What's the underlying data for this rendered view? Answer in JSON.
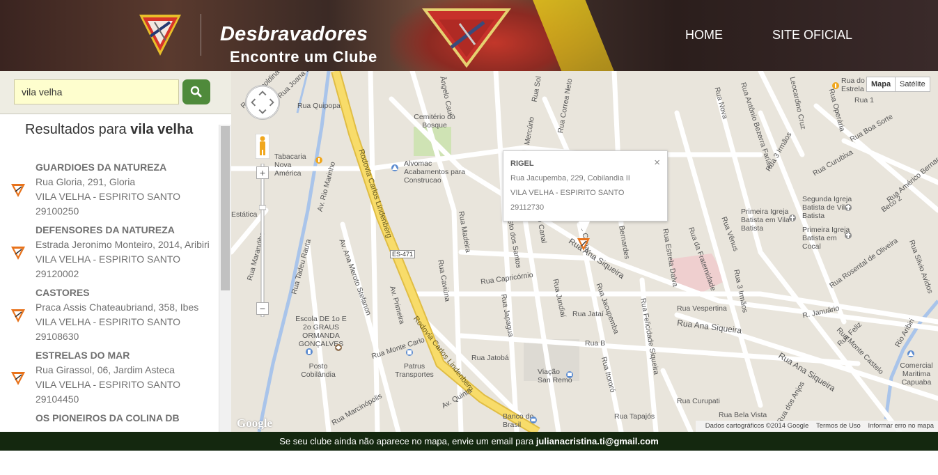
{
  "header": {
    "title": "Desbravadores",
    "subtitle": "Encontre um Clube",
    "nav": [
      "HOME",
      "SITE OFICIAL"
    ]
  },
  "search": {
    "value": "vila velha",
    "button_icon": "search-icon"
  },
  "results": {
    "prefix": "Resultados para",
    "query": "vila velha",
    "items": [
      {
        "name": "GUARDIOES DA NATUREZA",
        "address": "Rua Gloria, 291, Gloria",
        "city": "VILA VELHA - ESPIRITO SANTO",
        "cep": "29100250"
      },
      {
        "name": "DEFENSORES DA NATUREZA",
        "address": "Estrada Jeronimo Monteiro, 2014, Aribiri",
        "city": "VILA VELHA - ESPIRITO SANTO",
        "cep": "29120002"
      },
      {
        "name": "CASTORES",
        "address": "Praca Assis Chateaubriand, 358, Ibes",
        "city": "VILA VELHA - ESPIRITO SANTO",
        "cep": "29108630"
      },
      {
        "name": "ESTRELAS DO MAR",
        "address": "Rua Girassol, 06, Jardim Asteca",
        "city": "VILA VELHA - ESPIRITO SANTO",
        "cep": "29104450"
      },
      {
        "name": "OS PIONEIROS DA COLINA DB",
        "address": "",
        "city": "",
        "cep": ""
      }
    ]
  },
  "map": {
    "type_buttons": [
      "Mapa",
      "Satélite"
    ],
    "zoom_in": "+",
    "zoom_out": "−",
    "info": {
      "name": "RIGEL",
      "address": "Rua Jacupemba, 229, Cobilandia II",
      "city": "VILA VELHA - ESPIRITO SANTO",
      "cep": "29112730",
      "close": "×"
    },
    "labels": {
      "highway_1": "Rodovia Carlos Lindenberg",
      "highway_2": "Rodovia Carlos Lindenberg",
      "es471": "ES-471",
      "rua_quipopa": "Rua Quipopa",
      "cemiterio": "Cemitério do Bosque",
      "alvomac": "Alvomac Acabamentos para Construcao",
      "rua_capricornio": "Rua Capricórnio",
      "rua_ana_siqueira_1": "Rua Ana Siqueira",
      "rua_ana_siqueira_2": "Rua Ana Siqueira",
      "rua_ana_siqueira_3": "Rua Ana Siqueira",
      "rua_vespertina": "Rua Vespertina",
      "rua_janu": "R. Januário",
      "rua_monte_carlo": "Rua Monte Carlo",
      "escola": "Escola DE 1o E 2o GRAUS ORMANDA GONÇALVES",
      "posto": "Posto Cobilândia",
      "patrus": "Patrus Transportes",
      "viacao": "Viação San Remo",
      "banco": "Banco do Brasil",
      "igreja1": "Primeira Igreja Batista em Vila Batista",
      "igreja2": "Segunda Igreja Batista de Vila Batista",
      "igreja3": "Primeira Igreja Batista em Cocal",
      "comercial": "Comercial Maritima Capuaba",
      "rua_jacupemba": "Rua Jacupemba",
      "rua_jatai": "Rua Jataí",
      "rua_jatoba": "Rua Jatobá",
      "rua_jundiai": "Rua Jundiaí",
      "rua_japagua": "Rua Japagua",
      "rua_madeira": "Rua Madeira",
      "rua_caviuna": "Rua Caviúna",
      "av_primeira": "Av. Primeira",
      "av_quinta": "Av. Quinta",
      "rua_felicidade": "Rua Felicidade Siqueira",
      "rua_curupati": "Rua Curupati",
      "rua_bela_vista": "Rua Bela Vista",
      "rua_tapajos": "Rua Tapajós",
      "rua_estrela_dalva": "Rua Estrela Dalva",
      "rua_da_fraternidade": "Rua da Fraternidade",
      "rua_3_irmaos": "Rua 3 Irmãos",
      "rua_venus": "Rua Vênus",
      "rua_rosental": "Rua Rosental de Oliveira",
      "rua_silvio": "Rua Silvio Avidos",
      "rua_monte_castelo": "Rua Monte Castelo",
      "rio_aribiri": "Rio Aribiri",
      "av_rio_marinho": "Av. Rio Marinho",
      "av_ana_meroto": "Av. Ana Meroto Stefanon",
      "rua_tadeu_rauta": "Rua Tadeu Rauta",
      "rua_1": "Rua 1",
      "rua_boa_sorte": "Rua Boa Sorte",
      "rua_curubixa": "Rua Curubixa",
      "beco_2": "Beco 2",
      "rua_americo": "Rua Américo Bernardes",
      "rua_b": "Rua B",
      "rua_itororo": "Rua Itororó",
      "rua_bernardes": "Bernardes",
      "rua_feliz": "Rua Feliz",
      "rua_angelo": "Ângelo Cauí",
      "rua_leopoldina": "Rua Leopoldina",
      "rua_operaria": "Rua Operária",
      "rua_nova": "Rua Nova",
      "rua_antonio": "Rua Antônio Bezerra Farias",
      "rua_leocardino": "Leocardino Cruz",
      "rua_tres_irmaos_top": "Rua 3 Irmãos",
      "rua_ernesto": "Av. Ernesto Canal",
      "rua_estrela": "Rua Ernesto Canal",
      "rua_augusto": "Rua Augusto dos Santos",
      "rua_marcinopolis": "Rua Marcinópolis",
      "rua_anjos": "Rua dos Anjos",
      "tabacaria": "Tabacaria Nova América",
      "estatica": "Estática",
      "rua_marandibe": "Rua Marandibe",
      "rua_joana": "Rua Joana D",
      "rua_correa": "Rua Correa Neto",
      "mercurio": "Mercúrio",
      "rua_sol": "Rua Sol",
      "padaria": "Rua do Mar Estrela Da"
    },
    "attribution": [
      "Dados cartográficos ©2014 Google",
      "Termos de Uso",
      "Informar erro no mapa"
    ],
    "google": "Google"
  },
  "footer": {
    "text": "Se seu clube ainda não aparece no mapa, envie um email para",
    "email": "julianacristina.ti@gmail.com"
  },
  "colors": {
    "search_button": "#4f8a3b",
    "footer_bg": "#14280f",
    "highway": "#f5d55e",
    "marker": "#e8731c"
  }
}
